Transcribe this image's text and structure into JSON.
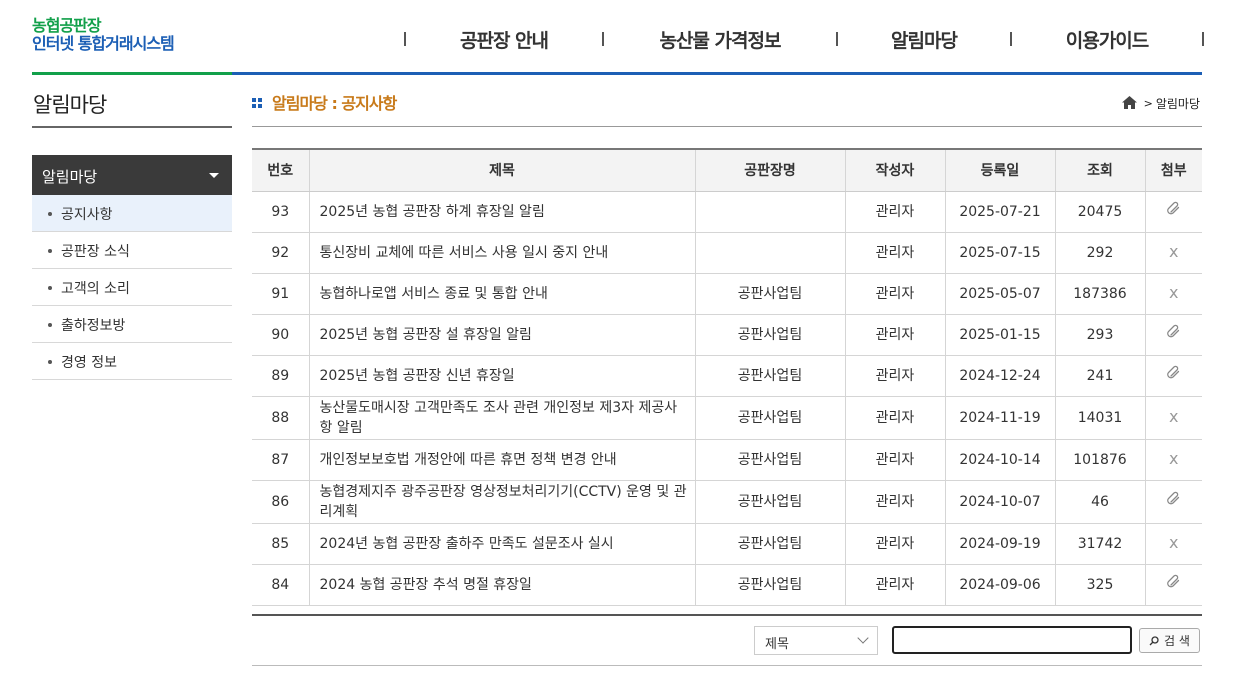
{
  "logo": {
    "line1": "농협공판장",
    "line2": "인터넷 통합거래시스템"
  },
  "gnb": [
    "공판장 안내",
    "농산물 가격정보",
    "알림마당",
    "이용가이드"
  ],
  "sidebar": {
    "title": "알림마당",
    "menu_head": "알림마당",
    "items": [
      {
        "label": "공지사항",
        "active": true
      },
      {
        "label": "공판장 소식"
      },
      {
        "label": "고객의 소리"
      },
      {
        "label": "출하정보방"
      },
      {
        "label": "경영 정보"
      }
    ]
  },
  "content": {
    "title": "알림마당 : 공지사항",
    "breadcrumb": "알림마당"
  },
  "table": {
    "headers": [
      "번호",
      "제목",
      "공판장명",
      "작성자",
      "등록일",
      "조회",
      "첨부"
    ],
    "rows": [
      {
        "no": "93",
        "title": "2025년 농협 공판장 하계 휴장일 알림",
        "market": "",
        "writer": "관리자",
        "date": "2025-07-21",
        "views": "20475",
        "attach": true
      },
      {
        "no": "92",
        "title": "통신장비 교체에 따른 서비스 사용 일시 중지 안내",
        "market": "",
        "writer": "관리자",
        "date": "2025-07-15",
        "views": "292",
        "attach": false
      },
      {
        "no": "91",
        "title": "농협하나로앱 서비스 종료 및 통합 안내",
        "market": "공판사업팀",
        "writer": "관리자",
        "date": "2025-05-07",
        "views": "187386",
        "attach": false
      },
      {
        "no": "90",
        "title": "2025년 농협 공판장 설 휴장일 알림",
        "market": "공판사업팀",
        "writer": "관리자",
        "date": "2025-01-15",
        "views": "293",
        "attach": true
      },
      {
        "no": "89",
        "title": "2025년 농협 공판장 신년 휴장일",
        "market": "공판사업팀",
        "writer": "관리자",
        "date": "2024-12-24",
        "views": "241",
        "attach": true
      },
      {
        "no": "88",
        "title": "농산물도매시장 고객만족도 조사 관련 개인정보 제3자 제공사항 알림",
        "market": "공판사업팀",
        "writer": "관리자",
        "date": "2024-11-19",
        "views": "14031",
        "attach": false
      },
      {
        "no": "87",
        "title": "개인정보보호법 개정안에 따른 휴면 정책 변경 안내",
        "market": "공판사업팀",
        "writer": "관리자",
        "date": "2024-10-14",
        "views": "101876",
        "attach": false
      },
      {
        "no": "86",
        "title": "농협경제지주 광주공판장 영상정보처리기기(CCTV) 운영 및 관리계획",
        "market": "공판사업팀",
        "writer": "관리자",
        "date": "2024-10-07",
        "views": "46",
        "attach": true
      },
      {
        "no": "85",
        "title": "2024년 농협 공판장 출하주 만족도 설문조사 실시",
        "market": "공판사업팀",
        "writer": "관리자",
        "date": "2024-09-19",
        "views": "31742",
        "attach": false
      },
      {
        "no": "84",
        "title": "2024 농협 공판장 추석 명절 휴장일",
        "market": "공판사업팀",
        "writer": "관리자",
        "date": "2024-09-06",
        "views": "325",
        "attach": true
      }
    ],
    "no_attach_mark": "x"
  },
  "search": {
    "select_value": "제목",
    "input_value": "",
    "button_label": "검 색"
  }
}
